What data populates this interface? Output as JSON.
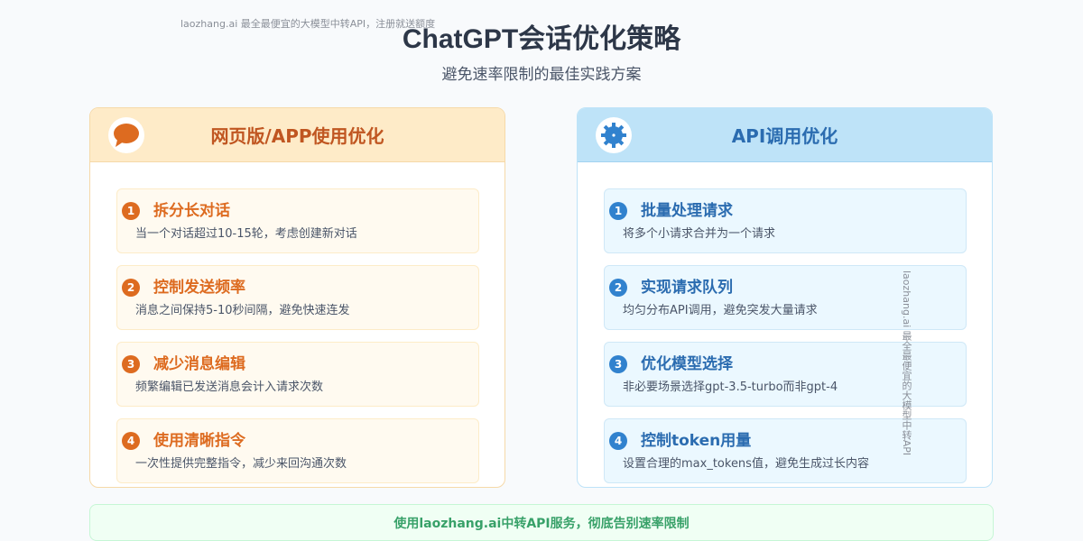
{
  "watermark": {
    "top": "laozhang.ai 最全最便宜的大模型中转API，注册就送额度",
    "side": "laozhang.ai 最全最便宜的大模型中转API"
  },
  "header": {
    "title": "ChatGPT会话优化策略",
    "subtitle": "避免速率限制的最佳实践方案"
  },
  "colors": {
    "orange_accent": "#dd6b20",
    "blue_accent": "#3182ce",
    "green_accent": "#38a169"
  },
  "panels": [
    {
      "title": "网页版/APP使用优化",
      "icon": "chat-bubble-icon",
      "items": [
        {
          "num": "1",
          "title": "拆分长对话",
          "desc": "当一个对话超过10-15轮，考虑创建新对话"
        },
        {
          "num": "2",
          "title": "控制发送频率",
          "desc": "消息之间保持5-10秒间隔，避免快速连发"
        },
        {
          "num": "3",
          "title": "减少消息编辑",
          "desc": "频繁编辑已发送消息会计入请求次数"
        },
        {
          "num": "4",
          "title": "使用清晰指令",
          "desc": "一次性提供完整指令，减少来回沟通次数"
        }
      ]
    },
    {
      "title": "API调用优化",
      "icon": "gear-icon",
      "items": [
        {
          "num": "1",
          "title": "批量处理请求",
          "desc": "将多个小请求合并为一个请求"
        },
        {
          "num": "2",
          "title": "实现请求队列",
          "desc": "均匀分布API调用，避免突发大量请求"
        },
        {
          "num": "3",
          "title": "优化模型选择",
          "desc": "非必要场景选择gpt-3.5-turbo而非gpt-4"
        },
        {
          "num": "4",
          "title": "控制token用量",
          "desc": "设置合理的max_tokens值，避免生成过长内容"
        }
      ]
    }
  ],
  "footer": {
    "text": "使用laozhang.ai中转API服务，彻底告别速率限制"
  }
}
